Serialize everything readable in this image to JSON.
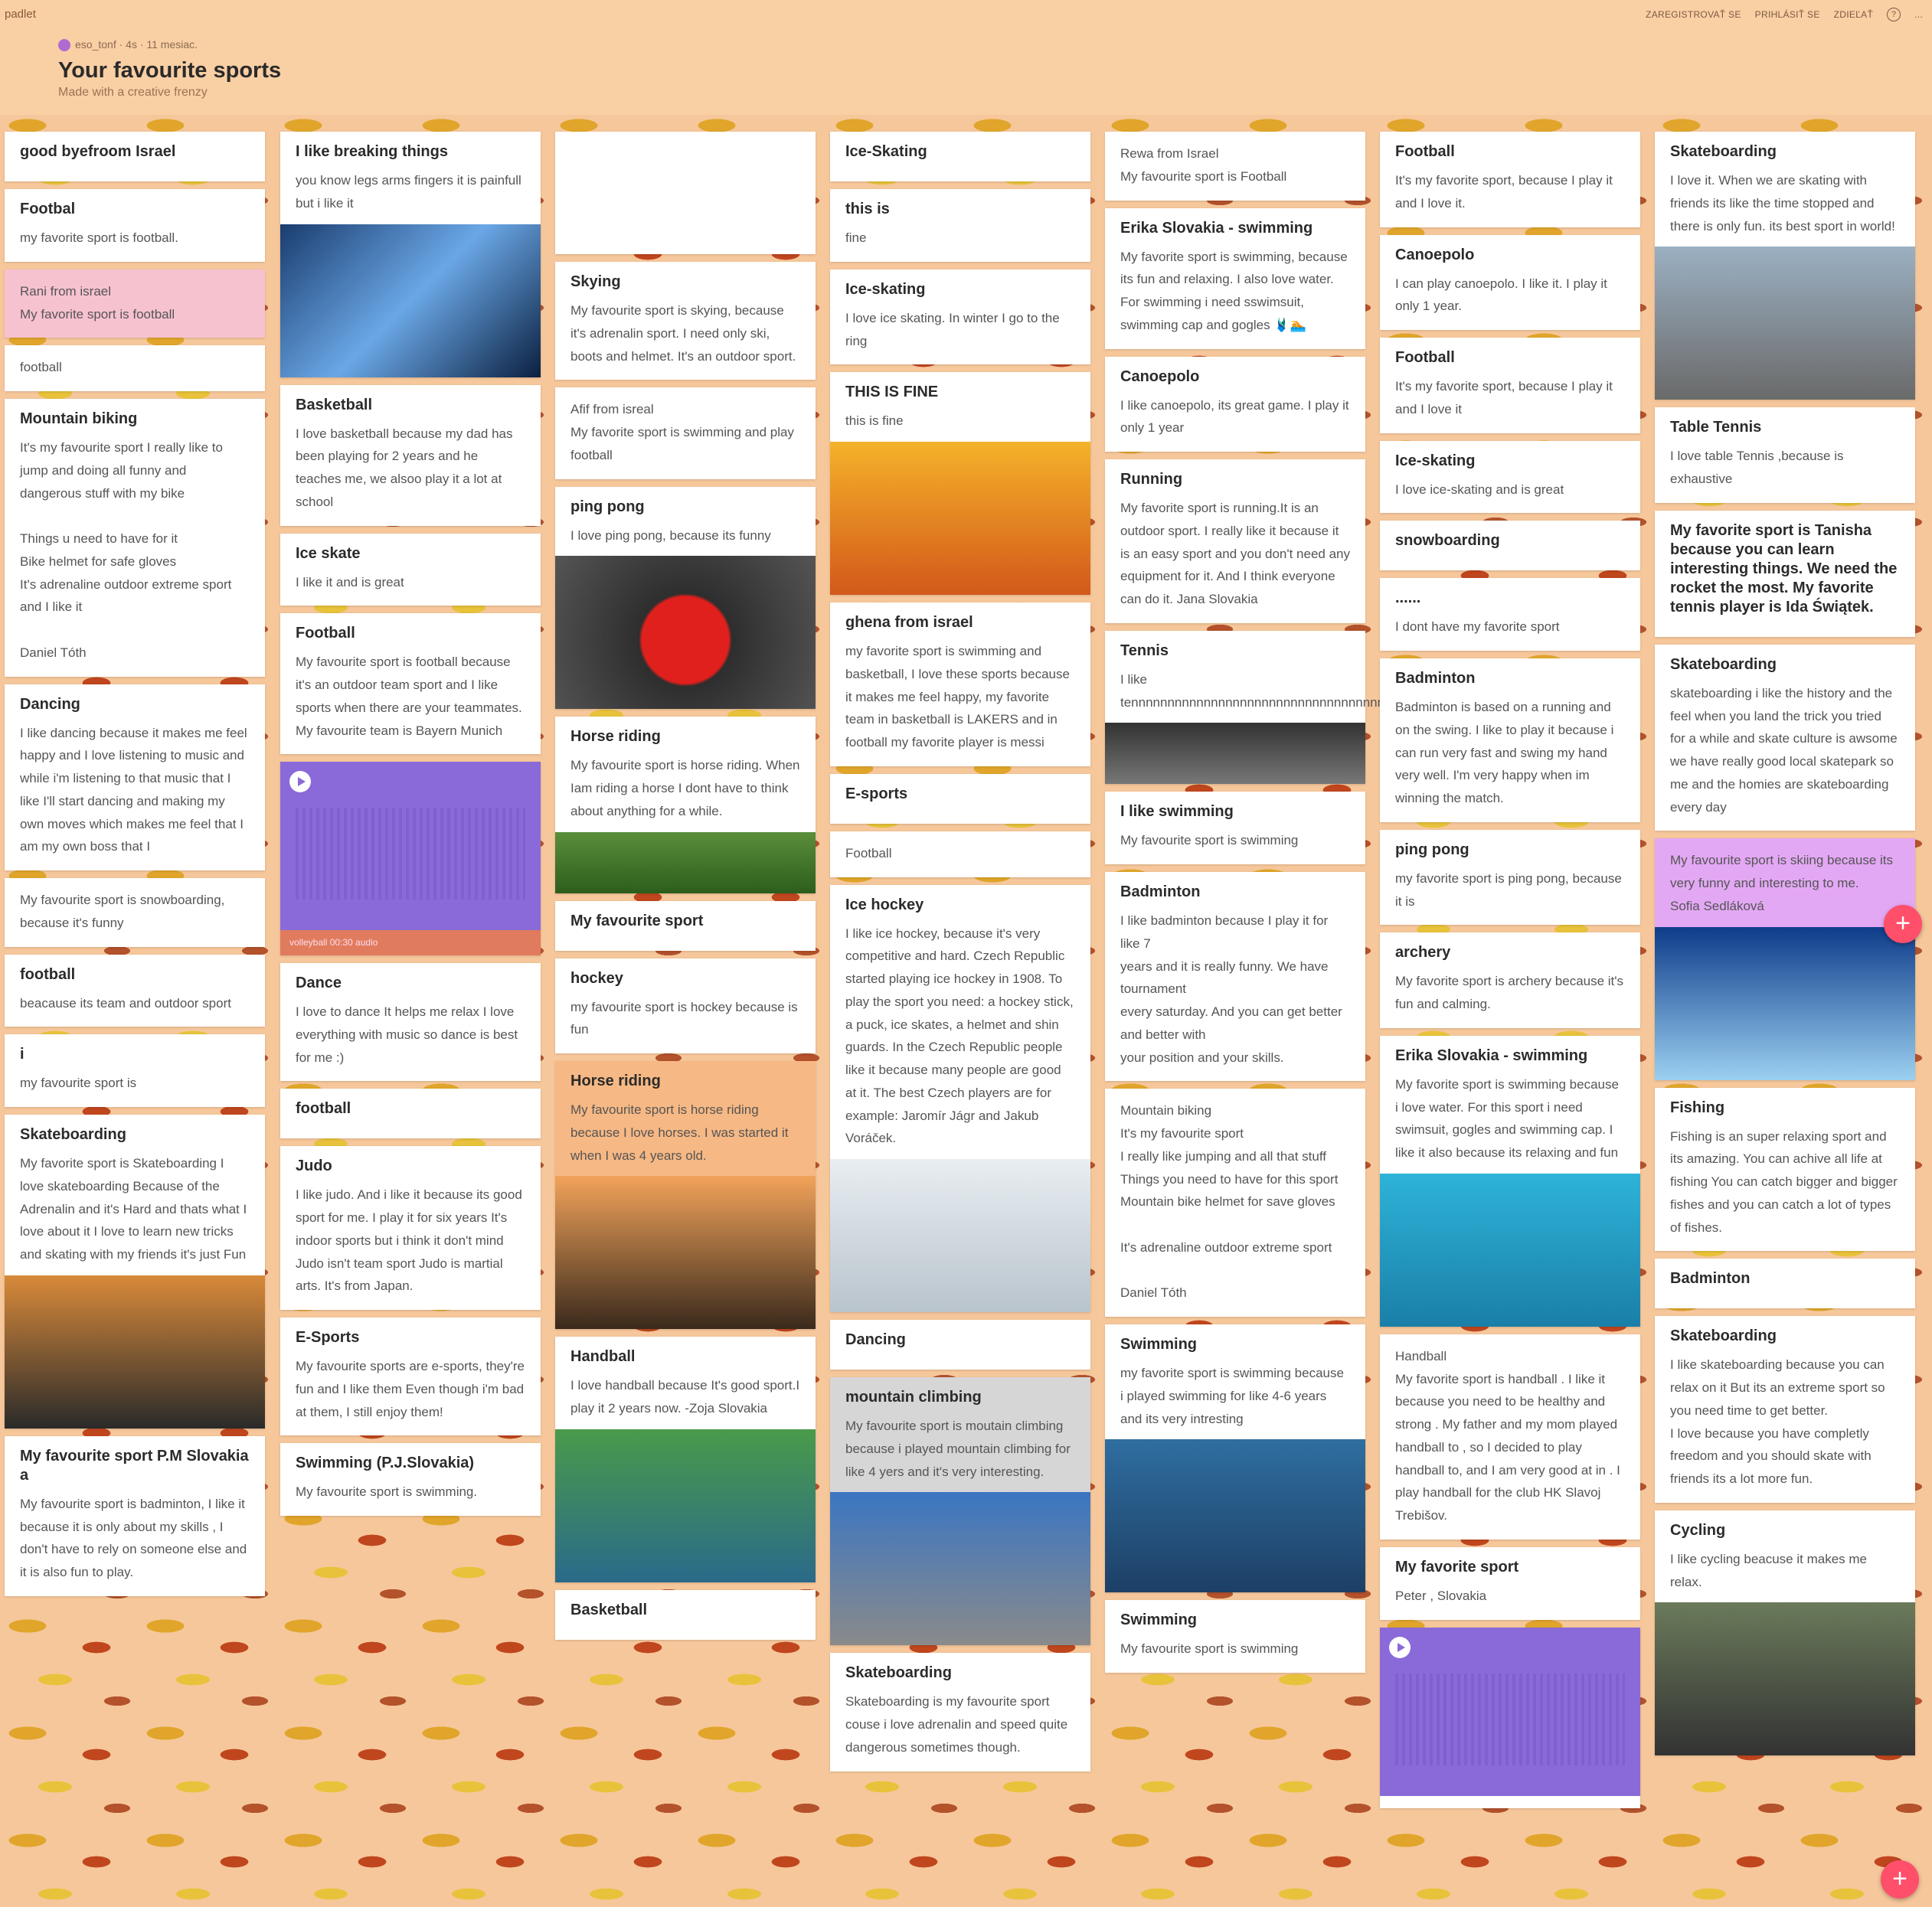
{
  "app": {
    "logo": "padlet"
  },
  "header": {
    "author": "eso_tonf · 4s · 11 mesiac.",
    "title": "Your favourite sports",
    "subtitle": "Made with a creative frenzy",
    "links": [
      "ZAREGISTROVAŤ SE",
      "PRIHLÁSIŤ SE",
      "ZDIEĽAŤ",
      "?",
      "..."
    ]
  },
  "columns": [
    {
      "cards": [
        {
          "title": "good byefroom Israel",
          "body": ""
        },
        {
          "title": "Footbal",
          "body": "my favorite sport is  football."
        },
        {
          "title": "",
          "body": "Rani from israel\nMy favorite sport is football",
          "style": "pink"
        },
        {
          "title": "",
          "body": "football"
        },
        {
          "title": "Mountain biking",
          "body": "It's my favourite sport I really like to jump and doing all funny and dangerous stuff with my bike\n\nThings u need to have for it\nBike helmet for safe gloves\nIt's adrenaline outdoor extreme sport and I like it\n\nDaniel Tóth"
        },
        {
          "title": "Dancing",
          "body": "I like dancing because it makes me feel happy and I love listening to music and while i'm listening to that music that I like I'll start dancing and making my own moves which makes me feel that I am my own boss that I"
        },
        {
          "title": "",
          "body": "My favourite sport is snowboarding, because it's funny"
        },
        {
          "title": "football",
          "body": "beacause its team and outdoor sport"
        },
        {
          "title": "i",
          "body": "my favourite sport is"
        },
        {
          "title": "Skateboarding",
          "body": "My favorite sport is  Skateboarding I love skateboarding Because of the Adrenalin and it's Hard and thats what I love about it  I love to learn new tricks and skating with my friends it's just Fun",
          "img": "skate"
        },
        {
          "title": "My favourite sport  P.M Slovakia a",
          "body": "My favourite sport is badminton,  I like it because it is only about my skills , I don't have to rely on someone else and it is also fun to play."
        }
      ]
    },
    {
      "cards": [
        {
          "title": "I like breaking things",
          "body": "you know legs arms fingers it is painfull  but i like it",
          "img": "xray"
        },
        {
          "title": "Basketball",
          "body": "I love basketball because my dad has been playing for 2 years  and he teaches me, we alsoo play it a lot at school"
        },
        {
          "title": "Ice skate",
          "body": "I like it and is great"
        },
        {
          "title": "Football",
          "body": "My favourite sport is football because it's an outdoor team sport and I like sports when there are your teammates. My favourite team is Bayern Munich"
        },
        {
          "title": "",
          "body": "",
          "audio": true,
          "audio_label": "volleyball\n00:30 audio"
        },
        {
          "title": "Dance",
          "body": "I love to dance  It helps me relax  I love everything with music so dance is best for me :)"
        },
        {
          "title": "football",
          "body": ""
        },
        {
          "title": "Judo",
          "body": "I like judo. And i like it because its good sport for me. I play it for six years  It's indoor sports but i think it don't mind  Judo isn't team sport  Judo is martial arts. It's from Japan."
        },
        {
          "title": "E-Sports",
          "body": "My favourite sports are e-sports, they're fun and I like them  Even though i'm bad at them, I still enjoy them!"
        },
        {
          "title": "Swimming (P.J.Slovakia)",
          "body": "My favourite sport is swimming."
        }
      ]
    },
    {
      "cards": [
        {
          "title": "",
          "body": "",
          "style": "empty"
        },
        {
          "title": "Skying",
          "body": "My favourite sport is skying, because it's adrenalin sport. I need only ski, boots and helmet. It's an outdoor sport."
        },
        {
          "title": "",
          "body": "Afif from isreal\nMy favorite sport is swimming and play football"
        },
        {
          "title": "ping pong",
          "body": "I love ping pong, because its funny",
          "img": "pingpong"
        },
        {
          "title": "Horse riding",
          "body": "My favourite sport is horse riding. When Iam riding a horse I dont have to think about anything for a while.",
          "img2": "soccer"
        },
        {
          "title": "My favourite sport",
          "body": ""
        },
        {
          "title": "hockey",
          "body": "my favourite sport is hockey because is fun"
        },
        {
          "title": "Horse riding",
          "body": "My favourite sport is horse riding because I love horses. I was started it when I was 4 years old.",
          "style": "orange",
          "img": "horse"
        },
        {
          "title": "Handball",
          "body": "I love handball because It's good sport.I play it 2 years now. -Zoja Slovakia",
          "img": "handball"
        },
        {
          "title": "Basketball",
          "body": ""
        }
      ]
    },
    {
      "cards": [
        {
          "title": "Ice-Skating",
          "body": ""
        },
        {
          "title": "this is",
          "body": "fine"
        },
        {
          "title": "Ice-skating",
          "body": "I love ice skating. In winter I go to the ring"
        },
        {
          "title": "THIS IS FINE",
          "body": "this is fine",
          "img": "fine"
        },
        {
          "title": "ghena from israel",
          "body": "my favorite sport is swimming and basketball, I love these sports because it makes me feel happy, my favorite team in basketball is LAKERS and in football my favorite player is messi"
        },
        {
          "title": "E-sports",
          "body": ""
        },
        {
          "title": "",
          "body": "Football"
        },
        {
          "title": "Ice hockey",
          "body": "I like ice hockey, because it's very competitive and hard. Czech Republic started playing ice hockey in 1908. To play the sport you need: a hockey stick, a puck, ice skates, a helmet and shin guards. In the Czech Republic people like it because many people are good at it. The best Czech players are for example: Jaromír Jágr and Jakub Voráček.",
          "img": "hockey"
        },
        {
          "title": "Dancing",
          "body": ""
        },
        {
          "title": "mountain climbing",
          "body": "My favourite sport is moutain climbing because i played mountain climbing for like 4 yers and it's very interesting.",
          "style": "grey",
          "img": "climb"
        },
        {
          "title": "Skateboarding",
          "body": "Skateboarding is my favourite sport couse i love adrenalin and speed quite dangerous sometimes though."
        }
      ]
    },
    {
      "cards": [
        {
          "title": "",
          "body": "Rewa from Israel\nMy favourite sport is Football"
        },
        {
          "title": "Erika Slovakia - swimming",
          "body": "My favorite sport is swimming, because its fun and relaxing. I also love water. For swimming i need sswimsuit, swimming cap and gogles 🩱🏊"
        },
        {
          "title": "Canoepolo",
          "body": "I like canoepolo, its great game. I play it only 1 year"
        },
        {
          "title": "Running",
          "body": "My favorite sport is running.It is an outdoor sport.  I really like it because it is an easy sport and you don't need any equipment for it. And I think everyone can do it.  Jana Slovakia"
        },
        {
          "title": "Tennis",
          "body": "I like tennnnnnnnnnnnnnnnnnnnnnnnnnnnnnnnnnnnnnnnnnnnnnis",
          "img2": "eyes"
        },
        {
          "title": "I like swimming",
          "body": "My favourite sport is swimming"
        },
        {
          "title": "Badminton",
          "body": "I like badminton because I play it for like 7\nyears and it is really funny. We have tournament\nevery saturday. And you can get better and better with\nyour position and your skills."
        },
        {
          "title": "",
          "body": "Mountain biking\nIt's my favourite sport\nI really like jumping and all that stuff\nThings you need to have for this sport\nMountain bike helmet for save gloves\n\nIt's adrenaline outdoor extreme sport\n\nDaniel Tóth"
        },
        {
          "title": "Swimming",
          "body": "my favorite sport is swimming because i played swimming for like 4-6 years and its very intresting",
          "img": "swim"
        },
        {
          "title": "Swimming",
          "body": "My favourite sport is swimming"
        }
      ]
    },
    {
      "cards": [
        {
          "title": "Football",
          "body": "It's my favorite sport, because I play it and I love it."
        },
        {
          "title": "Canoepolo",
          "body": "I can play canoepolo. I like it. I play it only 1 year."
        },
        {
          "title": "Football",
          "body": "It's my favorite sport, because I play it and I love it"
        },
        {
          "title": "Ice-skating",
          "body": "I love ice-skating and is great"
        },
        {
          "title": "snowboarding",
          "body": ""
        },
        {
          "title": "......",
          "body": "I dont have my favorite sport"
        },
        {
          "title": "Badminton",
          "body": "Badminton is based on a running and on the swing. I like to play it because i can run very fast and swing my hand very well. I'm very happy when im winning the match."
        },
        {
          "title": "ping pong",
          "body": "my favorite sport is ping pong, because it is"
        },
        {
          "title": "archery",
          "body": "My favorite sport is archery because it's fun and calming."
        },
        {
          "title": "Erika Slovakia - swimming",
          "body": "My favorite sport is swimming because i love water. For this sport i need swimsuit, gogles and swimming cap. I like it also because its relaxing and fun",
          "img": "pool"
        },
        {
          "title": "",
          "body": "Handball\nMy favorite sport is handball . I like it because you need to be healthy and strong . My father and my mom played handball to , so I decided to play handball to, and I am very good at in . I play handball for the club HK Slavoj Trebišov."
        },
        {
          "title": "My favorite sport",
          "body": "Peter , Slovakia"
        },
        {
          "title": "",
          "body": "",
          "audio": true,
          "audio_label": ""
        }
      ]
    },
    {
      "cards": [
        {
          "title": "Skateboarding",
          "body": "I love it. When we are skating with friends its like the time stopped and there is only fun. its best sport in world!",
          "img": "dog"
        },
        {
          "title": "Table Tennis",
          "body": "I love table Tennis ,because is exhaustive"
        },
        {
          "title": "My favorite sport is Tanisha because you can learn interesting things. We need the rocket the most. My favorite tennis player is Ida Świątek.",
          "body": ""
        },
        {
          "title": "Skateboarding",
          "body": "skateboarding i like the history and the feel when you land the trick you tried for a while and skate culture is awsome we have really good local skatepark so me and the homies are skateboarding every day"
        },
        {
          "title": "",
          "body": "My favourite sport is skiing because its very funny and interesting to me.\nSofia Sedláková",
          "style": "violet",
          "img": "ski"
        },
        {
          "title": "Fishing",
          "body": "Fishing is an super relaxing sport and its amazing. You can achive all life at fishing  You can catch bigger and bigger fishes and you can catch a lot of types of fishes."
        },
        {
          "title": "Badminton",
          "body": ""
        },
        {
          "title": "Skateboarding",
          "body": "I like skateboarding because you can relax on it  But its an extreme sport so you need time to get better.\nI love because you have completly freedom and you should skate with friends its a lot more fun."
        },
        {
          "title": "Cycling",
          "body": "I like cycling beacuse  it makes me relax.",
          "img": "cycle"
        }
      ]
    }
  ],
  "colors": {
    "accent": "#ff4f6a",
    "background": "#f7c79a"
  }
}
